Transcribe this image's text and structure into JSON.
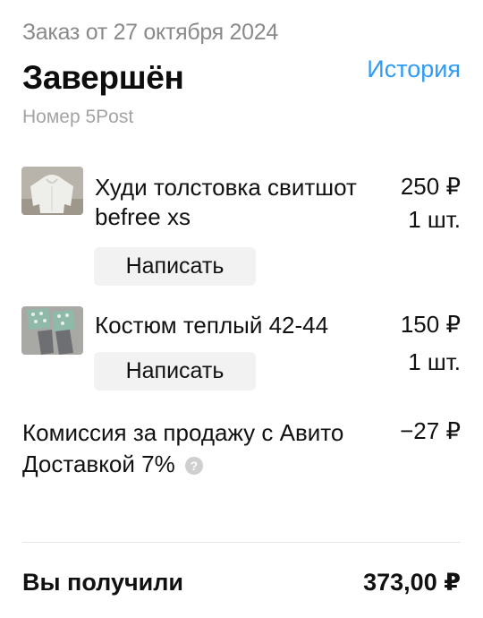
{
  "header": {
    "order_date": "Заказ от 27 октября 2024",
    "status": "Завершён",
    "history_link": "История",
    "order_number": "Номер 5Post"
  },
  "items": [
    {
      "name": "Худи толстовка свитшот befree xs",
      "price": "250 ₽",
      "quantity": "1 шт.",
      "write_button": "Написать",
      "thumbnail_icon": "hoodie-photo"
    },
    {
      "name": "Костюм теплый 42-44",
      "price": "150 ₽",
      "quantity": "1 шт.",
      "write_button": "Написать",
      "thumbnail_icon": "suit-photo"
    }
  ],
  "commission": {
    "label": "Комиссия за продажу с Авито Доставкой 7%",
    "value": "−27 ₽",
    "help_icon": "?"
  },
  "total": {
    "label": "Вы получили",
    "value": "373,00 ₽"
  },
  "colors": {
    "accent": "#2f9bf5",
    "muted": "#8a8a8a",
    "button_bg": "#f2f2f2"
  }
}
